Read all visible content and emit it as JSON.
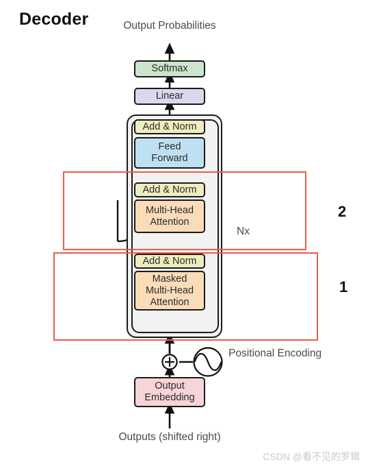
{
  "page": {
    "title": "Decoder",
    "watermark": "CSDN @看不见的罗辑",
    "background_color": "#ffffff"
  },
  "diagram": {
    "type": "transformer-decoder-architecture",
    "top_label": {
      "line1": "Output",
      "line2": "Probabilities"
    },
    "bottom_label": {
      "line1": "Outputs",
      "line2": "(shifted right)"
    },
    "repeat_label": "Nx",
    "positional_encoding_label": {
      "line1": "Positional",
      "line2": "Encoding"
    },
    "add_symbol": "+",
    "blocks": [
      {
        "id": "softmax",
        "label": "Softmax",
        "color": "#cde4cd"
      },
      {
        "id": "linear",
        "label": "Linear",
        "color": "#d9d8ec"
      },
      {
        "id": "add-norm-3",
        "label": "Add & Norm",
        "color": "#eeedbe"
      },
      {
        "id": "feed-forward",
        "label_line1": "Feed",
        "label_line2": "Forward",
        "color": "#bfe0f0"
      },
      {
        "id": "add-norm-2",
        "label": "Add & Norm",
        "color": "#eeedbe"
      },
      {
        "id": "multi-head-attention",
        "label_line1": "Multi-Head",
        "label_line2": "Attention",
        "color": "#fadcb8"
      },
      {
        "id": "add-norm-1",
        "label": "Add & Norm",
        "color": "#eeedbe"
      },
      {
        "id": "masked-multi-head-attention",
        "label_line1": "Masked",
        "label_line2": "Multi-Head",
        "label_line3": "Attention",
        "color": "#fadcb8"
      },
      {
        "id": "output-embedding",
        "label_line1": "Output",
        "label_line2": "Embedding",
        "color": "#f7d4d8"
      }
    ],
    "annotations": [
      {
        "id": "region-2",
        "number": "2",
        "covers": "cross-attention sublayer (Add & Norm + Multi-Head Attention)",
        "color": "#f05a46"
      },
      {
        "id": "region-1",
        "number": "1",
        "covers": "masked self-attention sublayer (Add & Norm + Masked Multi-Head Attention)",
        "color": "#f05a46"
      }
    ]
  }
}
